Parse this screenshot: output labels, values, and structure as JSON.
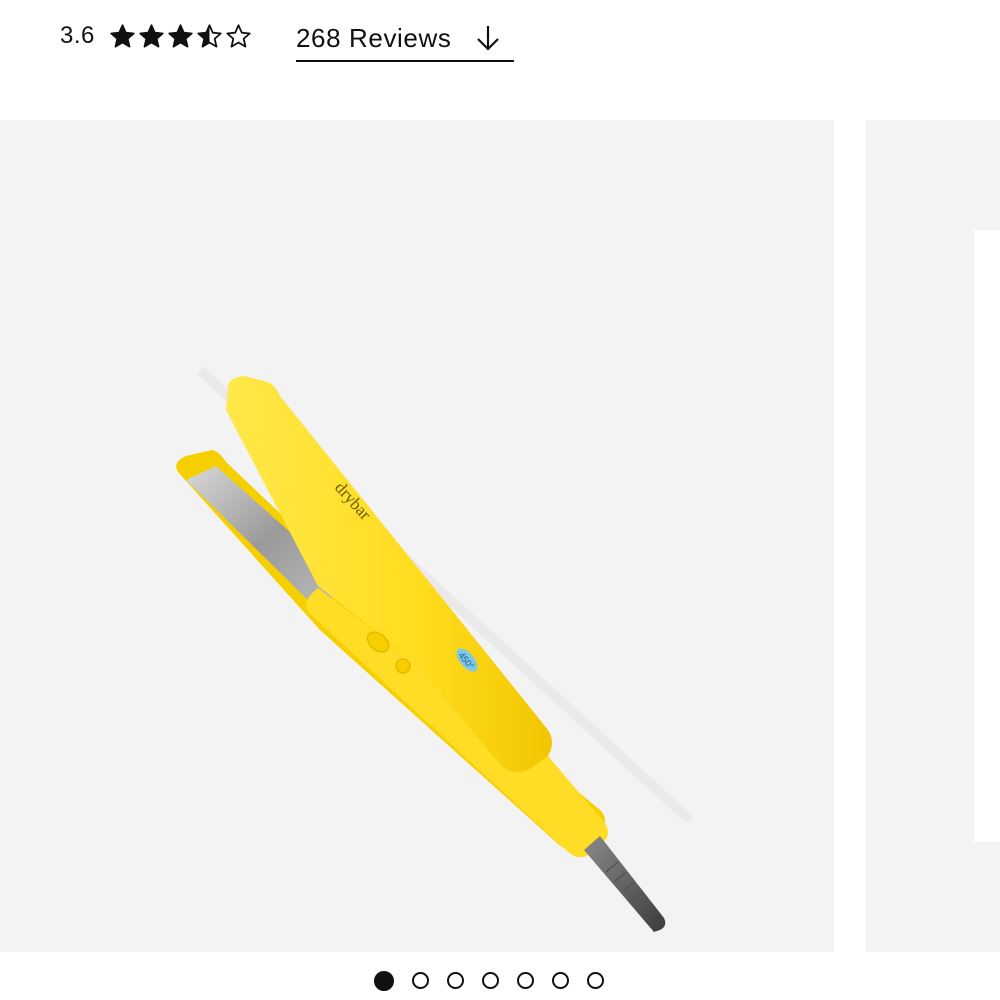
{
  "rating": {
    "value": "3.6",
    "stars": [
      "full",
      "full",
      "full",
      "half",
      "empty"
    ]
  },
  "reviews": {
    "label": "268 Reviews",
    "icon": "arrow-down-icon"
  },
  "product": {
    "brand_mark": "drybar",
    "temperature_display": "450°"
  },
  "gallery": {
    "active_index": 0,
    "dots": [
      1,
      2,
      3,
      4,
      5,
      6,
      7
    ]
  },
  "colors": {
    "product_yellow": "#ffe02a",
    "background": "#f3f3f3",
    "text": "#111111"
  }
}
